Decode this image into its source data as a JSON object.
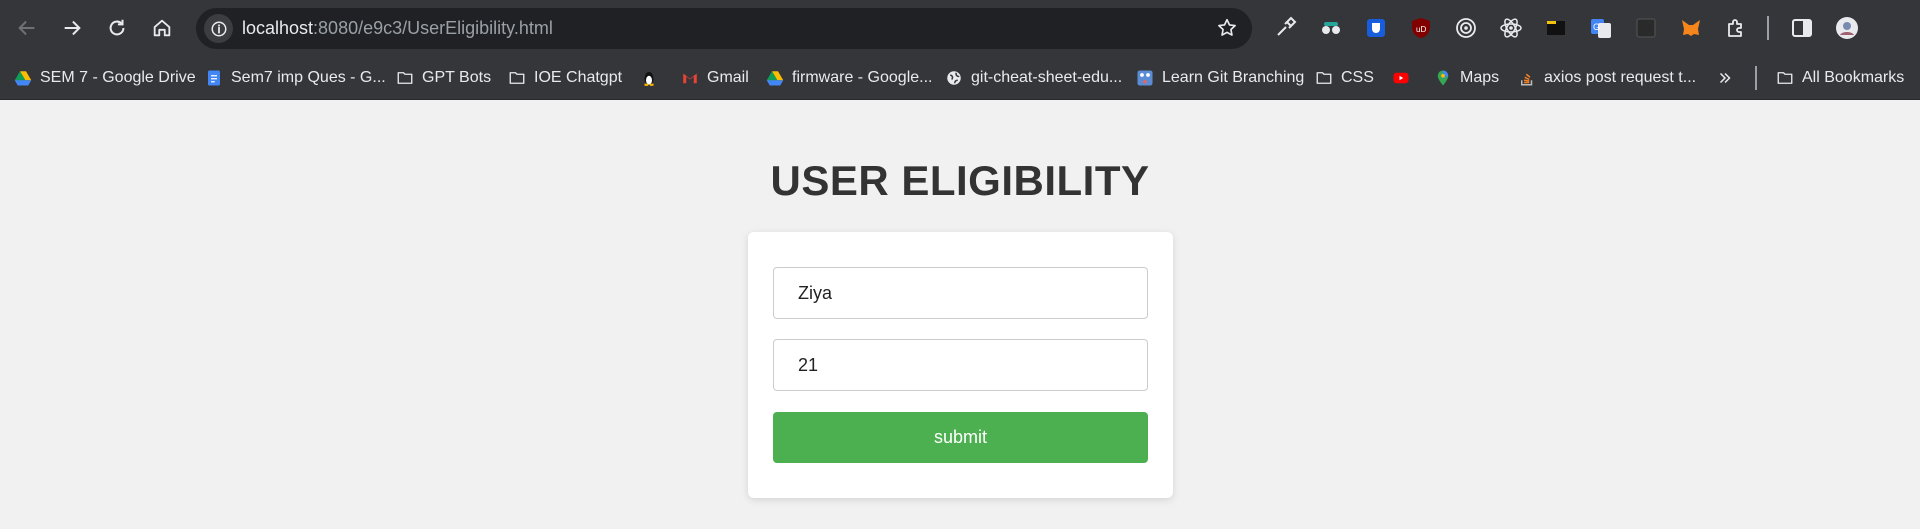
{
  "browser": {
    "url_host": "localhost",
    "url_rest": ":8080/e9c3/UserEligibility.html",
    "bookmarks": [
      {
        "label": "SEM 7 - Google Drive",
        "icon": "google-drive-icon"
      },
      {
        "label": "Sem7 imp Ques - G...",
        "icon": "google-docs-icon"
      },
      {
        "label": "GPT Bots",
        "icon": "folder-icon"
      },
      {
        "label": "IOE Chatgpt",
        "icon": "folder-icon"
      },
      {
        "label": "",
        "icon": "linux-penguin-icon"
      },
      {
        "label": "Gmail",
        "icon": "gmail-icon"
      },
      {
        "label": "firmware - Google...",
        "icon": "google-drive-icon"
      },
      {
        "label": "git-cheat-sheet-edu...",
        "icon": "globe-icon"
      },
      {
        "label": "Learn Git Branching",
        "icon": "git-branching-icon"
      },
      {
        "label": "CSS",
        "icon": "folder-icon"
      },
      {
        "label": "",
        "icon": "youtube-icon"
      },
      {
        "label": "Maps",
        "icon": "google-maps-icon"
      },
      {
        "label": "axios post request t...",
        "icon": "stackoverflow-icon"
      }
    ],
    "all_bookmarks_label": "All Bookmarks"
  },
  "page": {
    "title": "USER ELIGIBILITY",
    "name_value": "Ziya",
    "age_value": "21",
    "submit_label": "submit"
  },
  "colors": {
    "accent": "#4caf50",
    "background": "#f1f1f1",
    "title": "#333333"
  }
}
